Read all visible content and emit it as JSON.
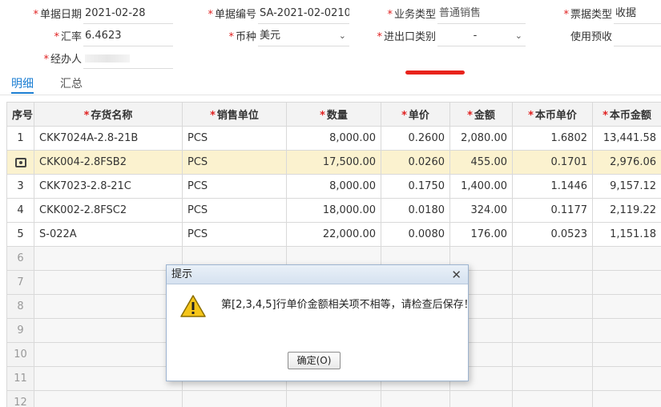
{
  "header": {
    "doc_date": {
      "label": "单据日期",
      "value": "2021-02-28"
    },
    "doc_no": {
      "label": "单据编号",
      "value": "SA-2021-02-0210"
    },
    "biz_type": {
      "label": "业务类型",
      "value": "普通销售"
    },
    "ticket_type": {
      "label": "票据类型",
      "value": "收据"
    },
    "exchange_rate": {
      "label": "汇率",
      "value": "6.4623"
    },
    "currency": {
      "label": "币种",
      "value": "美元"
    },
    "import_export": {
      "label": "进出口类别",
      "value": "-"
    },
    "use_advance": {
      "label": "使用预收",
      "value": ""
    },
    "handler": {
      "label": "经办人",
      "value": ""
    }
  },
  "tabs": [
    {
      "label": "明细",
      "active": true
    },
    {
      "label": "汇总",
      "active": false
    }
  ],
  "table": {
    "columns": [
      "序号",
      "存货名称",
      "销售单位",
      "数量",
      "单价",
      "金额",
      "本币单价",
      "本币金额"
    ],
    "required_columns": [
      1,
      2,
      3,
      4,
      5,
      6,
      7
    ],
    "rows": [
      {
        "seq": "1",
        "name": "CKK7024A-2.8-21B",
        "unit": "PCS",
        "qty": "8,000.00",
        "price": "0.2600",
        "amount": "2,080.00",
        "local_price": "1.6802",
        "local_amount": "13,441.58",
        "selected": false
      },
      {
        "seq": "",
        "name": "CKK004-2.8FSB2",
        "unit": "PCS",
        "qty": "17,500.00",
        "price": "0.0260",
        "amount": "455.00",
        "local_price": "0.1701",
        "local_amount": "2,976.06",
        "selected": true
      },
      {
        "seq": "3",
        "name": "CKK7023-2.8-21C",
        "unit": "PCS",
        "qty": "8,000.00",
        "price": "0.1750",
        "amount": "1,400.00",
        "local_price": "1.1446",
        "local_amount": "9,157.12",
        "selected": false
      },
      {
        "seq": "4",
        "name": "CKK002-2.8FSC2",
        "unit": "PCS",
        "qty": "18,000.00",
        "price": "0.0180",
        "amount": "324.00",
        "local_price": "0.1177",
        "local_amount": "2,119.22",
        "selected": false
      },
      {
        "seq": "5",
        "name": "S-022A",
        "unit": "PCS",
        "qty": "22,000.00",
        "price": "0.0080",
        "amount": "176.00",
        "local_price": "0.0523",
        "local_amount": "1,151.18",
        "selected": false
      }
    ],
    "empty_rows": [
      "6",
      "7",
      "8",
      "9",
      "10",
      "11",
      "12"
    ]
  },
  "dialog": {
    "title": "提示",
    "message": "第[2,3,4,5]行单价金额相关项不相等，请检查后保存！",
    "ok_label": "确定(O)",
    "icon": "warning-icon"
  },
  "colors": {
    "accent": "#1d7fd3",
    "required_star": "#e02020",
    "selected_row": "#fbf2cf",
    "annotation_mark": "#e8231c"
  }
}
